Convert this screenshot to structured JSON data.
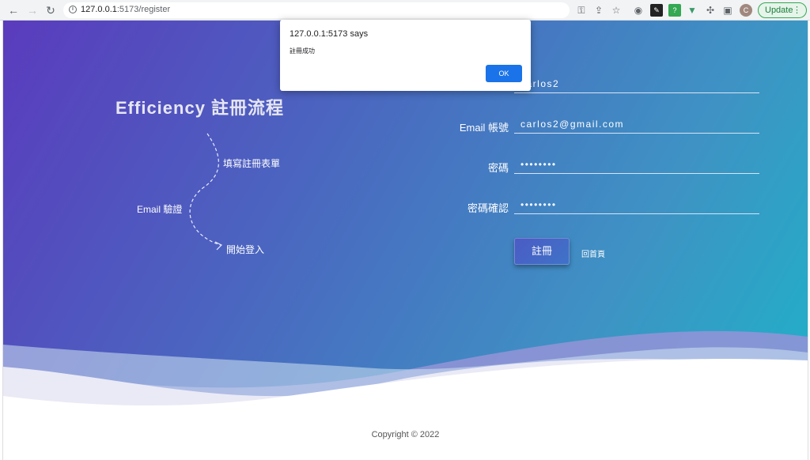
{
  "browser": {
    "url_host": "127.0.0.1",
    "url_path": ":5173/register",
    "update_label": "Update",
    "avatar_initial": "C",
    "icons": [
      "back-icon",
      "forward-icon",
      "reload-icon",
      "key-icon",
      "share-icon",
      "star-icon",
      "camera-icon",
      "extension-icon",
      "puzzle-icon",
      "sidepanel-icon"
    ]
  },
  "hero": {
    "title": "Efficiency 註冊流程",
    "steps": {
      "fill_form": "填寫註冊表單",
      "email_verify": "Email 驗證",
      "start_login": "開始登入"
    }
  },
  "form": {
    "username_value": "carlos2",
    "email_label": "Email 帳號",
    "email_value": "carlos2@gmail.com",
    "password_label": "密碼",
    "password_value": "••••••••",
    "confirm_label": "密碼確認",
    "confirm_value": "••••••••",
    "submit_label": "註冊",
    "home_link": "回首頁"
  },
  "footer": {
    "copyright": "Copyright © 2022"
  },
  "dialog": {
    "title": "127.0.0.1:5173 says",
    "message": "註冊成功",
    "ok_label": "OK"
  },
  "colors": {
    "gradient_start": "#5a3bbd",
    "gradient_end": "#20b0c8",
    "ok_button": "#1a73e8",
    "update_green": "#188038"
  }
}
